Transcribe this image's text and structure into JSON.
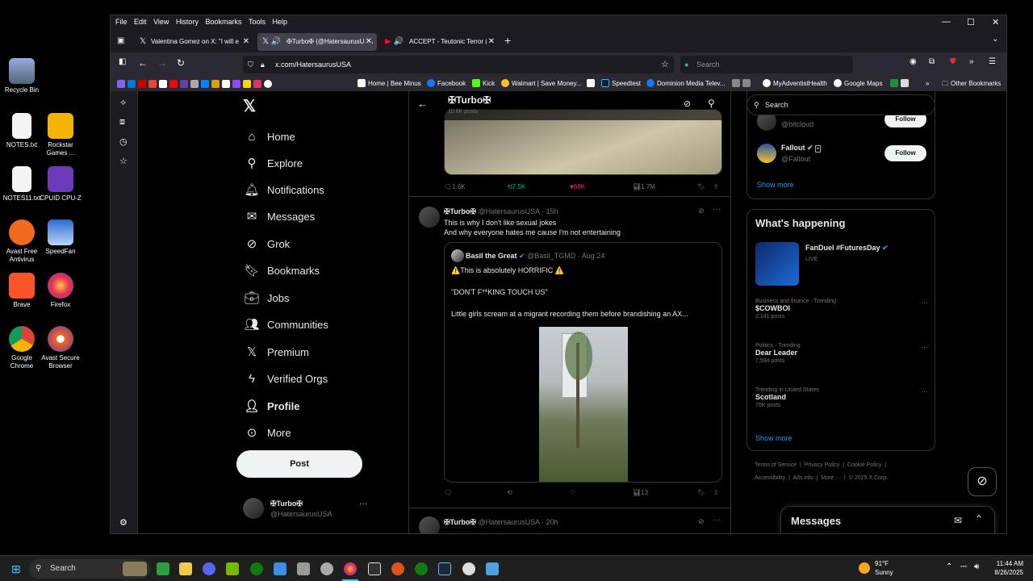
{
  "desktop": {
    "icons": [
      {
        "label": "Recycle Bin",
        "icon": "recycle-bin-icon"
      },
      {
        "label": "NOTES.txt",
        "icon": "text-file-icon"
      },
      {
        "label": "Rockstar Games ...",
        "icon": "rockstar-icon"
      },
      {
        "label": "NOTES11.txt",
        "icon": "text-file-icon"
      },
      {
        "label": "CPUID CPU-Z",
        "icon": "cpuz-icon"
      },
      {
        "label": "Avast Free Antivirus",
        "icon": "avast-icon"
      },
      {
        "label": "SpeedFan",
        "icon": "speedfan-icon"
      },
      {
        "label": "Brave",
        "icon": "brave-icon"
      },
      {
        "label": "Firefox",
        "icon": "firefox-icon"
      },
      {
        "label": "Google Chrome",
        "icon": "chrome-icon"
      },
      {
        "label": "Avast Secure Browser",
        "icon": "avast-browser-icon"
      }
    ]
  },
  "browser": {
    "menu": [
      "File",
      "Edit",
      "View",
      "History",
      "Bookmarks",
      "Tools",
      "Help"
    ],
    "tabs": [
      {
        "title": "Valentina Gomez on X: \"I will e",
        "icon": "x-icon",
        "active": false
      },
      {
        "title": "✠Turbo✠ (@HatersaurusUSA",
        "icon": "x-icon",
        "active": true
      },
      {
        "title": "ACCEPT - Teutonic Terror (O",
        "icon": "youtube-icon",
        "active": false
      }
    ],
    "url": "x.com/HatersaurusUSA",
    "search_placeholder": "Search",
    "bookmarks": [
      "Home | Bee Minus",
      "Facebook",
      "Kick",
      "Walmart | Save Money...",
      "Speedtest",
      "Dominion Media Telev...",
      "MyAdventistHealth",
      "Google Maps",
      "Other Bookmarks"
    ]
  },
  "x": {
    "nav": [
      {
        "label": "Home",
        "icon": "home-icon"
      },
      {
        "label": "Explore",
        "icon": "search-icon"
      },
      {
        "label": "Notifications",
        "icon": "bell-icon"
      },
      {
        "label": "Messages",
        "icon": "mail-icon"
      },
      {
        "label": "Grok",
        "icon": "grok-icon"
      },
      {
        "label": "Bookmarks",
        "icon": "bookmark-icon"
      },
      {
        "label": "Jobs",
        "icon": "briefcase-icon"
      },
      {
        "label": "Communities",
        "icon": "people-icon"
      },
      {
        "label": "Premium",
        "icon": "x-icon"
      },
      {
        "label": "Verified Orgs",
        "icon": "lightning-icon"
      },
      {
        "label": "Profile",
        "icon": "person-icon"
      },
      {
        "label": "More",
        "icon": "more-circle-icon"
      }
    ],
    "post_label": "Post",
    "account": {
      "name": "✠Turbo✠",
      "handle": "@HatersaurusUSA"
    },
    "timeline_header": {
      "name": "✠Turbo✠",
      "posts": "10.6K posts"
    },
    "tweet1_stats": {
      "replies": "1.6K",
      "reposts": "7.5K",
      "likes": "68K",
      "views": "1.7M"
    },
    "tweet2": {
      "name": "✠Turbo✠",
      "handle": "@HatersaurusUSA",
      "time": "15h",
      "text1": "This is why I don't like sexual jokes",
      "text2": "And why everyone hates me cause I'm not entertaining",
      "quote": {
        "name": "Basil the Great",
        "handle": "@Basil_TGMD",
        "date": "Aug 24",
        "line1": "⚠️This is absolutely HORRIFIC ⚠️",
        "line2": "\"DON'T F**KING TOUCH US\"",
        "line3": "Little girls scream at a migrant recording them before brandishing an AX..."
      },
      "views": "13"
    },
    "tweet3": {
      "name": "✠Turbo✠",
      "handle": "@HatersaurusUSA",
      "time": "20h"
    },
    "right": {
      "search_placeholder": "Search",
      "who_follow": [
        {
          "handle": "@bitcloud",
          "button": "Follow"
        },
        {
          "name": "Fallout",
          "handle": "@Fallout",
          "button": "Follow"
        }
      ],
      "show_more": "Show more",
      "happening_title": "What's happening",
      "featured": {
        "title": "FanDuel #FuturesDay",
        "status": "LIVE"
      },
      "trends": [
        {
          "context": "Business and finance · Trending",
          "title": "$COWBOI",
          "count": "2,141 posts"
        },
        {
          "context": "Politics · Trending",
          "title": "Dear Leader",
          "count": "7,594 posts"
        },
        {
          "context": "Trending in United States",
          "title": "Scotland",
          "count": "76K posts"
        }
      ],
      "show_more2": "Show more",
      "footer1": [
        "Terms of Service",
        "Privacy Policy",
        "Cookie Policy"
      ],
      "footer2": [
        "Accessibility",
        "Ads info",
        "More ···",
        "© 2025 X Corp."
      ],
      "messages_label": "Messages"
    }
  },
  "taskbar": {
    "search": "Search",
    "weather_temp": "91°F",
    "weather_desc": "Sunny",
    "time": "11:44 AM",
    "date": "8/26/2025"
  },
  "colors": {
    "accent": "#1d9bf0",
    "like": "#f91880",
    "repost": "#00ba7c"
  }
}
